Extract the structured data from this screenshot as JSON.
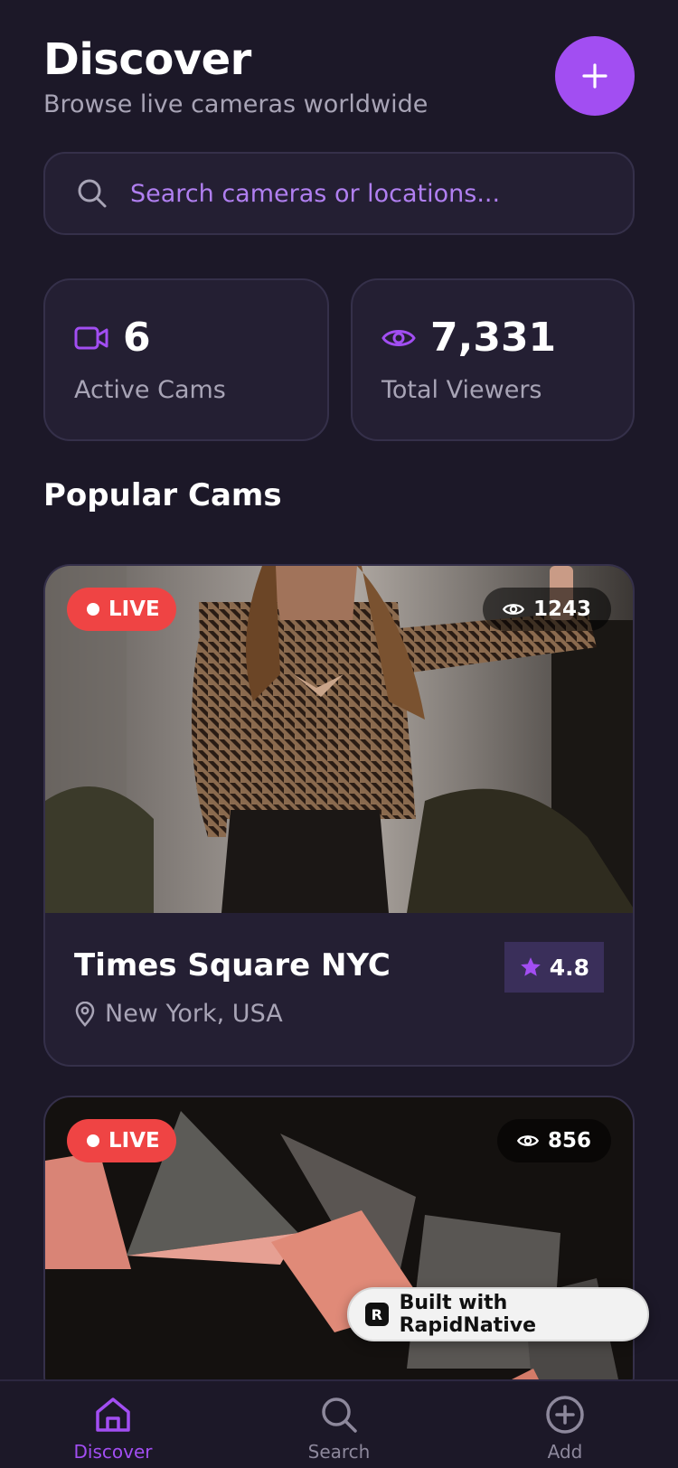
{
  "header": {
    "title": "Discover",
    "subtitle": "Browse live cameras worldwide"
  },
  "search": {
    "placeholder": "Search cameras or locations..."
  },
  "stats": [
    {
      "icon": "video-camera-icon",
      "value": "6",
      "label": "Active Cams"
    },
    {
      "icon": "eye-icon",
      "value": "7,331",
      "label": "Total Viewers"
    }
  ],
  "section_title": "Popular Cams",
  "cams": [
    {
      "live_label": "LIVE",
      "viewers": "1243",
      "name": "Times Square NYC",
      "location": "New York, USA",
      "rating": "4.8"
    },
    {
      "live_label": "LIVE",
      "viewers": "856"
    }
  ],
  "badge": {
    "label": "Built with RapidNative"
  },
  "tabs": [
    {
      "label": "Discover",
      "icon": "home-icon",
      "active": true
    },
    {
      "label": "Search",
      "icon": "search-icon",
      "active": false
    },
    {
      "label": "Add",
      "icon": "plus-circle-icon",
      "active": false
    }
  ],
  "colors": {
    "background": "#1c1828",
    "card": "#241f33",
    "accent": "#a24ef2",
    "live": "#ef4444",
    "muted": "#a8a4b6"
  }
}
